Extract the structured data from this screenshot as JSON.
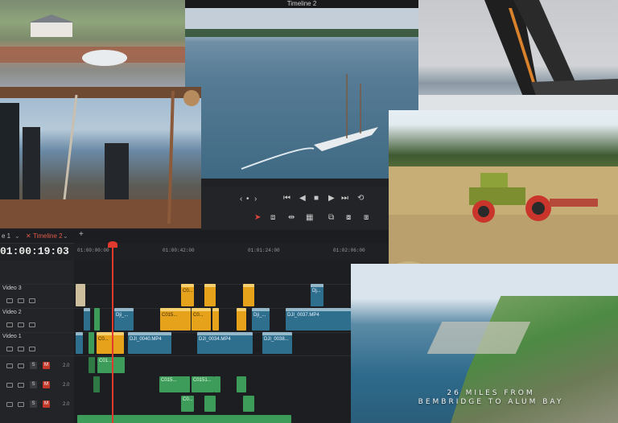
{
  "window": {
    "title": "Timeline 2"
  },
  "tabs": [
    {
      "label": "e 1"
    },
    {
      "label": "Timeline 2"
    }
  ],
  "timeline": {
    "timecode": "01:00:19:03",
    "ruler": [
      "01:00:00:00",
      "01:00:42:00",
      "01:01:24:00",
      "01:02:06:00"
    ],
    "tracks": [
      {
        "name": "Video 3"
      },
      {
        "name": "Video 2"
      },
      {
        "name": "Video 1"
      }
    ],
    "audio_levels": [
      "2.0",
      "2.0",
      "2.0"
    ],
    "solo_label": "S",
    "mute_label": "M",
    "clips": {
      "v3_c1": "C0...",
      "v3_c2": "Dj...",
      "v2_c1": "Dji_...",
      "v2_c2": "C015...",
      "v2_c3": "C0...",
      "v2_c4": "Dji_...",
      "v2_c5": "DJI_0037.MP4",
      "v1_c1": "C0...",
      "v1_c2": "DJI_0040.MP4",
      "v1_c3": "DJI_0034.MP4",
      "v1_c4": "DJI_0038...",
      "a1_c1": "C01...",
      "a2_c1": "C015...",
      "a2_c2": "C0151...",
      "a3_c1": "C0..."
    }
  },
  "photo_caption": "26 MILES FROM\nBEMBRIDGE TO ALUM BAY",
  "icons": {
    "prev": "chevron-left-icon",
    "dot": "dot-icon",
    "next": "chevron-right-icon",
    "skip_back": "skip-back-icon",
    "play_back": "play-reverse-icon",
    "stop": "stop-icon",
    "play": "play-icon",
    "skip_fwd": "skip-forward-icon",
    "loop": "loop-icon"
  },
  "colors": {
    "accent_red": "#e0392d",
    "clip_blue": "#2f6f8e",
    "clip_orange": "#e6a21a",
    "clip_green": "#3e9c5a"
  }
}
